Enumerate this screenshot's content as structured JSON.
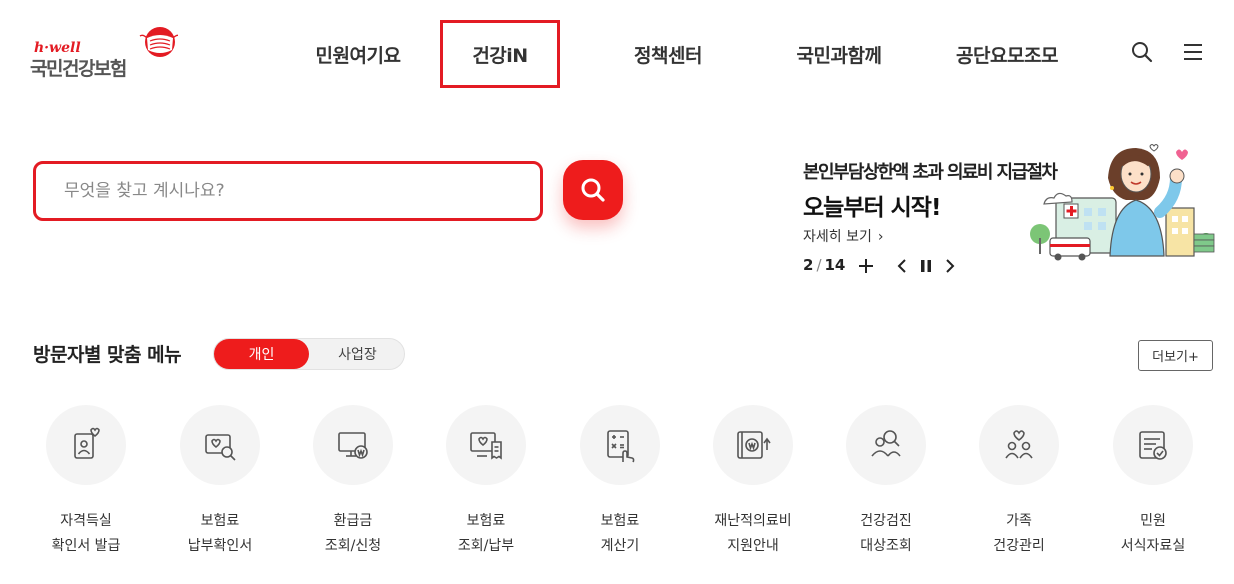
{
  "header": {
    "logo_small": "h·well",
    "logo_name": "국민건강보험",
    "nav": [
      {
        "label": "민원여기요"
      },
      {
        "label": "건강iN"
      },
      {
        "label": "정책센터"
      },
      {
        "label": "국민과함께"
      },
      {
        "label": "공단요모조모"
      }
    ],
    "icons": [
      "search-icon",
      "hamburger-menu-icon"
    ]
  },
  "search": {
    "placeholder": "무엇을 찾고 계시나요?",
    "value": "",
    "button_icon": "search-icon"
  },
  "banner": {
    "title_line1": "본인부담상한액 초과 의료비 지급절차",
    "title_line2": "오늘부터 시작!",
    "more_label": "자세히 보기",
    "current": "2",
    "total": "14"
  },
  "visitor_menu": {
    "title": "방문자별 맞춤 메뉴",
    "tabs": [
      {
        "label": "개인",
        "active": true
      },
      {
        "label": "사업장",
        "active": false
      }
    ],
    "more_label": "더보기+",
    "items": [
      {
        "line1": "자격득실",
        "line2": "확인서 발급",
        "icon": "id-card-heart-icon"
      },
      {
        "line1": "보험료",
        "line2": "납부확인서",
        "icon": "document-search-icon"
      },
      {
        "line1": "환급금",
        "line2": "조회/신청",
        "icon": "monitor-won-icon"
      },
      {
        "line1": "보험료",
        "line2": "조회/납부",
        "icon": "monitor-receipt-icon"
      },
      {
        "line1": "보험료",
        "line2": "계산기",
        "icon": "calculator-hand-icon"
      },
      {
        "line1": "재난적의료비",
        "line2": "지원안내",
        "icon": "wallet-won-icon"
      },
      {
        "line1": "건강검진",
        "line2": "대상조회",
        "icon": "people-search-icon"
      },
      {
        "line1": "가족",
        "line2": "건강관리",
        "icon": "family-heart-icon"
      },
      {
        "line1": "민원",
        "line2": "서식자료실",
        "icon": "document-check-icon"
      }
    ]
  },
  "colors": {
    "accent": "#ee1c1c",
    "highlight_border": "#e31b23",
    "icon_stroke": "#555555",
    "circle_bg": "#f4f4f4"
  }
}
